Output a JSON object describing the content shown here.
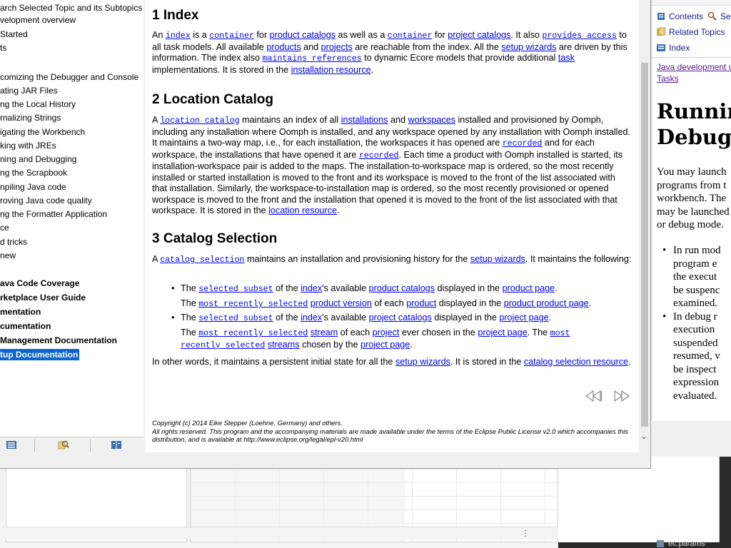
{
  "toc": {
    "header": "arch Selected Topic and its Subtopics",
    "items": [
      {
        "label": "velopment overview",
        "bold": false,
        "selected": false
      },
      {
        "label": " Started",
        "bold": false,
        "selected": false
      },
      {
        "label": "ts",
        "bold": false,
        "selected": false
      },
      {
        "label": "comizing the Debugger and Console",
        "bold": false,
        "selected": false
      },
      {
        "label": "ating JAR Files",
        "bold": false,
        "selected": false
      },
      {
        "label": "ng the Local History",
        "bold": false,
        "selected": false
      },
      {
        "label": "rnalizing Strings",
        "bold": false,
        "selected": false
      },
      {
        "label": "igating the Workbench",
        "bold": false,
        "selected": false
      },
      {
        "label": "king with JREs",
        "bold": false,
        "selected": false
      },
      {
        "label": "ning and Debugging",
        "bold": false,
        "selected": false
      },
      {
        "label": "ng the Scrapbook",
        "bold": false,
        "selected": false
      },
      {
        "label": "npiling Java code",
        "bold": false,
        "selected": false
      },
      {
        "label": "roving Java code quality",
        "bold": false,
        "selected": false
      },
      {
        "label": "ng the Formatter Application",
        "bold": false,
        "selected": false
      },
      {
        "label": "ce",
        "bold": false,
        "selected": false
      },
      {
        "label": "d tricks",
        "bold": false,
        "selected": false
      },
      {
        "label": "new",
        "bold": false,
        "selected": false
      },
      {
        "label": "ava Code Coverage",
        "bold": true,
        "selected": false
      },
      {
        "label": "rketplace User Guide",
        "bold": true,
        "selected": false
      },
      {
        "label": "mentation",
        "bold": true,
        "selected": false
      },
      {
        "label": "cumentation",
        "bold": true,
        "selected": false
      },
      {
        "label": "Management Documentation",
        "bold": true,
        "selected": false
      },
      {
        "label": "tup Documentation",
        "bold": true,
        "selected": true
      }
    ]
  },
  "sections": {
    "index": {
      "heading": "1  Index"
    },
    "location": {
      "heading": "2  Location Catalog"
    },
    "catalog": {
      "heading": "3  Catalog Selection"
    }
  },
  "footer": {
    "line1": "Copyright (c) 2014 Eike Stepper (Loehne, Germany) and others.",
    "line2": "All rights reserved. This program and the accompanying materials are made available under the terms of the Eclipse Public License v2.0 which accompanies this distribution, and is available at http://www.eclipse.org/legal/epl-v20.html"
  },
  "help_view": {
    "tabs": [
      "Contents",
      "Related Topics",
      "Index"
    ],
    "tab_cut": "Se",
    "crumb1": "Java development u",
    "crumb2": "Tasks",
    "title1": "Running",
    "title2": "Debugg",
    "para": [
      "You may launch",
      "programs from t",
      "workbench.  The",
      "may be launched",
      "or debug mode."
    ],
    "list1": [
      "In run mod",
      "program e",
      "the execut",
      "be suspenc",
      "examined."
    ],
    "list2": [
      "In debug r",
      "execution",
      "suspended",
      "resumed, v",
      "be inspect",
      "expression",
      "evaluated."
    ]
  },
  "bg": {
    "ec_params": "ec.params"
  },
  "colors": {
    "link": "#0000ee",
    "selection": "#0a64d2"
  }
}
